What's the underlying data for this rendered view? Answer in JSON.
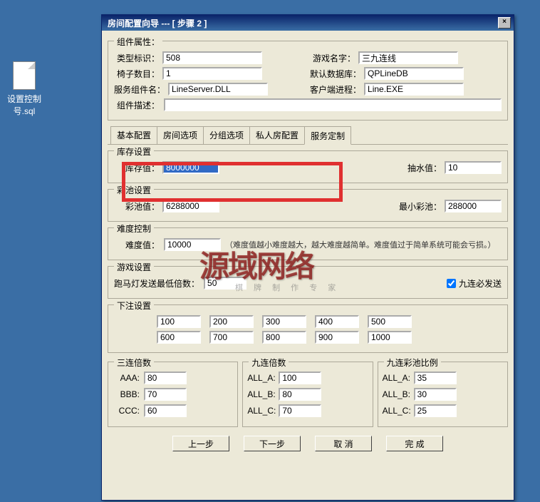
{
  "desktop": {
    "file_label": "设置控制号.sql"
  },
  "window": {
    "title": "房间配置向导 --- [ 步骤 2 ]",
    "close_x": "×"
  },
  "attrs": {
    "legend": "组件属性：",
    "type_label": "类型标识：",
    "type_val": "508",
    "game_label": "游戏名字：",
    "game_val": "三九连线",
    "chair_label": "椅子数目：",
    "chair_val": "1",
    "db_label": "默认数据库：",
    "db_val": "QPLineDB",
    "srv_label": "服务组件名：",
    "srv_val": "LineServer.DLL",
    "client_label": "客户端进程：",
    "client_val": "Line.EXE",
    "desc_label": "组件描述：",
    "desc_val": ""
  },
  "tabs": {
    "t1": "基本配置",
    "t2": "房间选项",
    "t3": "分组选项",
    "t4": "私人房配置",
    "t5": "服务定制"
  },
  "stock": {
    "legend": "库存设置",
    "stock_label": "库存值：",
    "stock_val": "8000000",
    "pump_label": "抽水值：",
    "pump_val": "10"
  },
  "pool": {
    "legend": "彩池设置",
    "pool_label": "彩池值：",
    "pool_val": "6288000",
    "min_label": "最小彩池：",
    "min_val": "288000"
  },
  "diff": {
    "legend": "难度控制",
    "label": "难度值：",
    "val": "10000",
    "hint": "（难度值越小难度越大，越大难度越简单。难度值过于简单系统可能会亏损。）"
  },
  "game": {
    "legend": "游戏设置",
    "marquee_label": "跑马灯发送最低倍数：",
    "marquee_val": "50",
    "nine_check": "九连必发送"
  },
  "bet": {
    "legend": "下注设置",
    "r1": [
      "100",
      "200",
      "300",
      "400",
      "500"
    ],
    "r2": [
      "600",
      "700",
      "800",
      "900",
      "1000"
    ]
  },
  "triple": {
    "g1": {
      "legend": "三连倍数",
      "aaa_l": "AAA:",
      "aaa_v": "80",
      "bbb_l": "BBB:",
      "bbb_v": "70",
      "ccc_l": "CCC:",
      "ccc_v": "60"
    },
    "g2": {
      "legend": "九连倍数",
      "a_l": "ALL_A:",
      "a_v": "100",
      "b_l": "ALL_B:",
      "b_v": "80",
      "c_l": "ALL_C:",
      "c_v": "70"
    },
    "g3": {
      "legend": "九连彩池比例",
      "a_l": "ALL_A:",
      "a_v": "35",
      "b_l": "ALL_B:",
      "b_v": "30",
      "c_l": "ALL_C:",
      "c_v": "25"
    }
  },
  "buttons": {
    "prev": "上一步",
    "next": "下一步",
    "cancel": "取 消",
    "finish": "完 成"
  },
  "watermark": {
    "main": "源域网络",
    "sub": "棋 牌 制 作 专 家"
  }
}
